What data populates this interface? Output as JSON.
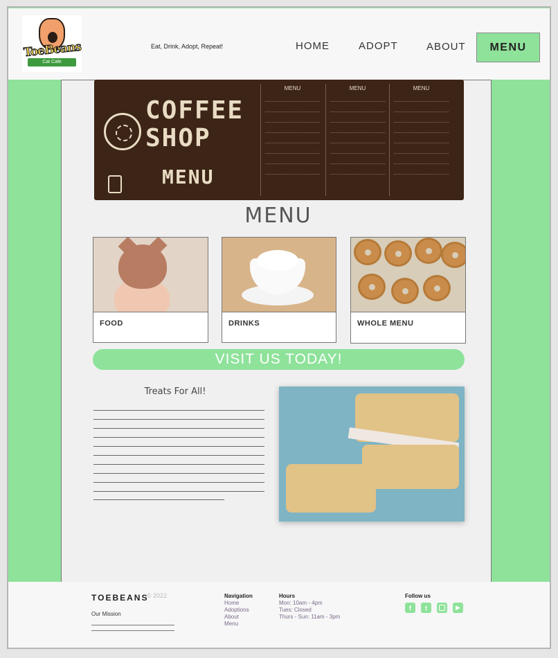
{
  "header": {
    "logo_text": "ToeBeans",
    "logo_sub": "Cat Cafe",
    "tagline": "Eat, Drink, Adopt, Repeat!",
    "nav": {
      "home": "HOME",
      "adopt": "ADOPT",
      "about": "ABOUT",
      "menu": "MENU"
    }
  },
  "banner": {
    "line1": "COFFEE",
    "line2": "SHOP",
    "line3": "MENU",
    "col_head": "MENU"
  },
  "main": {
    "title": "MENU",
    "cards": [
      {
        "label": "FOOD"
      },
      {
        "label": "DRINKS"
      },
      {
        "label": "WHOLE MENU"
      }
    ],
    "visit_button": "VISIT US TODAY!",
    "treats_heading": "Treats For All!"
  },
  "footer": {
    "brand": "TOEBEANS",
    "copyright": "© 2022",
    "mission": "Our Mission",
    "navigation": {
      "heading": "Navigation",
      "items": [
        "Home",
        "Adoptions",
        "About",
        "Menu"
      ]
    },
    "hours": {
      "heading": "Hours",
      "items": [
        "Mon: 10am - 4pm",
        "Tues: Closed",
        "Thurs - Sun: 11am - 3pm"
      ]
    },
    "follow": "Follow us",
    "social_icons": [
      "facebook-icon",
      "twitter-icon",
      "instagram-icon",
      "youtube-icon"
    ]
  },
  "colors": {
    "accent": "#8ee29a",
    "header_bg": "#f7f7f7",
    "content_bg": "#f0f0f0"
  }
}
